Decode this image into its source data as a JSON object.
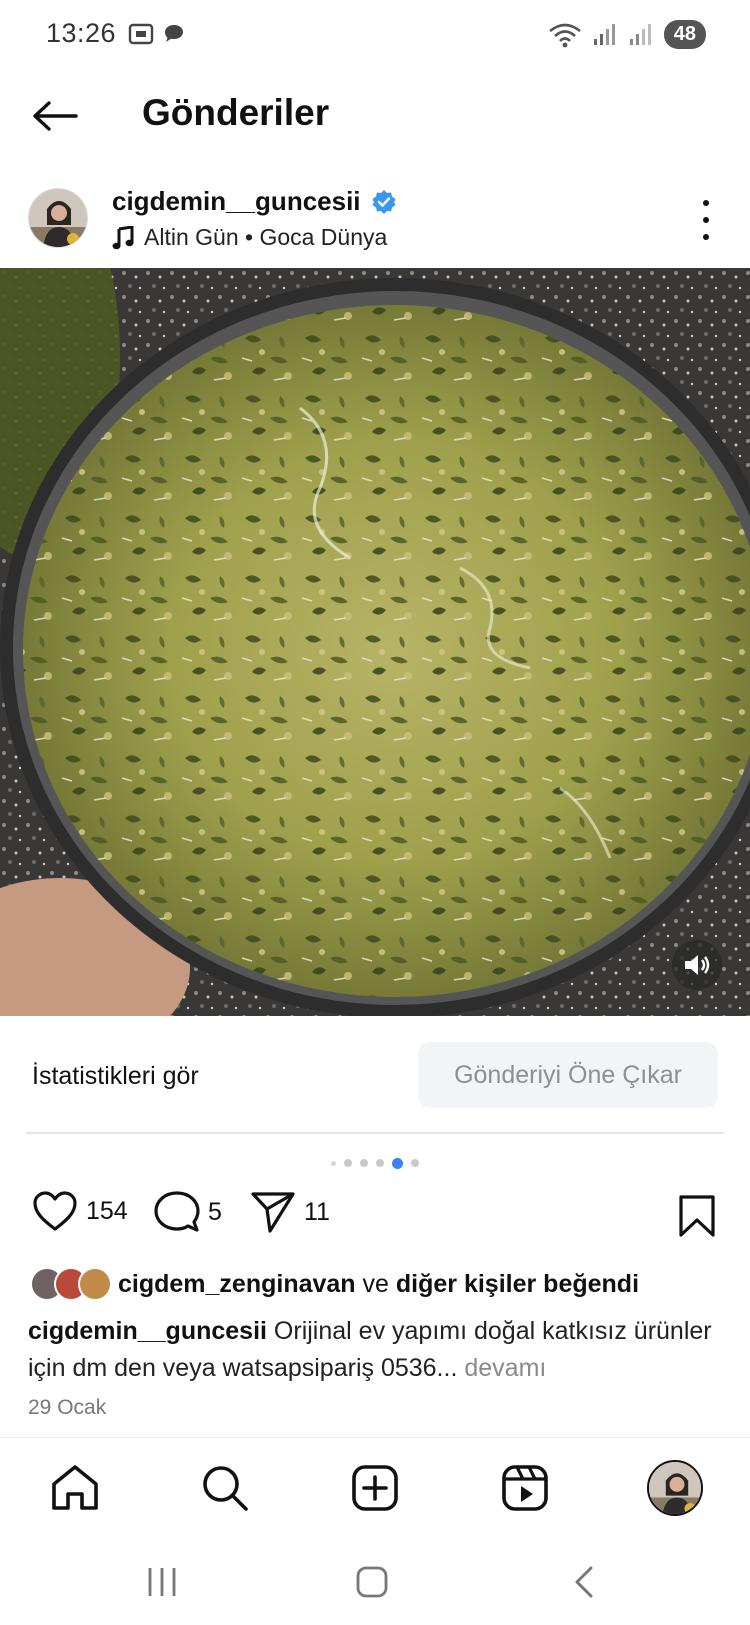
{
  "status_bar": {
    "time": "13:26",
    "battery": "48",
    "icons": [
      "screenshot-icon",
      "chat-bubble-icon",
      "wifi-icon",
      "signal-icon",
      "signal-icon"
    ]
  },
  "header": {
    "title": "Gönderiler"
  },
  "post": {
    "username": "cigdemin__guncesii",
    "verified": true,
    "music": "Altin Gün • Goca Dünya",
    "image_description_icon": "food-photo",
    "stats_label": "İstatistikleri gör",
    "promote_label": "Gönderiyi Öne Çıkar",
    "carousel": {
      "total": 6,
      "active_index": 4
    },
    "likes_count": "154",
    "comments_count": "5",
    "shares_count": "11",
    "liked_by_user": "cigdem_zenginavan",
    "liked_by_connector": "ve",
    "liked_by_rest": "diğer kişiler beğendi",
    "caption_user": "cigdemin__guncesii",
    "caption_text": "Orijinal ev yapımı doğal katkısız ürünler için dm den veya watsapsipariş 0536...",
    "caption_more": "devamı",
    "date": "29 Ocak"
  },
  "colors": {
    "accent": "#3b82f6",
    "verified": "#3897f0",
    "promote_bg": "#f3f4f7",
    "promote_text": "#8b8f96"
  }
}
